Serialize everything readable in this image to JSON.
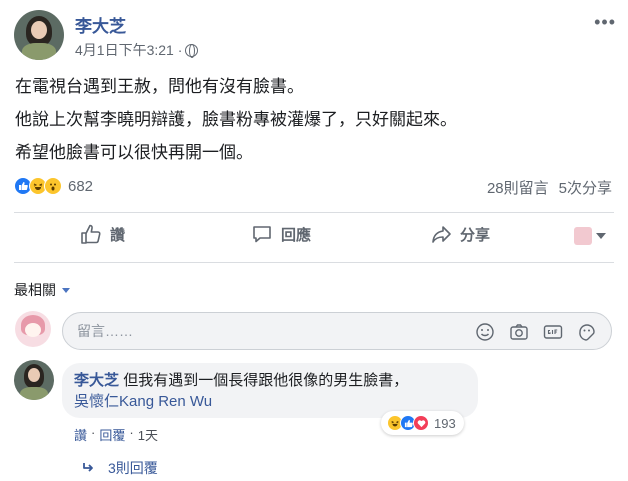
{
  "post": {
    "author": "李大芝",
    "time": "4月1日下午3:21 ·",
    "more": "•••",
    "lines": [
      "在電視台遇到王赦，問他有沒有臉書。",
      "他說上次幫李曉明辯護，臉書粉專被灌爆了，只好關起來。",
      "希望他臉書可以很快再開一個。"
    ],
    "reaction_count": "682",
    "comment_count": "28則留言",
    "share_count": "5次分享"
  },
  "actions": {
    "like": "讚",
    "comment": "回應",
    "share": "分享"
  },
  "comments_section": {
    "sort_label": "最相關",
    "input_placeholder": "留言……"
  },
  "comment": {
    "author": "李大芝",
    "text": "但我有遇到一個長得跟他很像的男生臉書，",
    "tag": "吳懷仁Kang Ren Wu",
    "reaction_count": "193",
    "like_link": "讚",
    "reply_link": "回覆",
    "time": "1天",
    "sep": "·",
    "replies": "3則回覆"
  },
  "icons": [
    "globe-icon",
    "like-icon",
    "comment-icon",
    "share-icon",
    "smile-icon",
    "camera-icon",
    "gif-icon",
    "sticker-icon",
    "reply-arrow-icon"
  ],
  "colors": {
    "link": "#385898",
    "like": "#2078f4",
    "love": "#f33e58",
    "haha": "#fcc52c"
  }
}
